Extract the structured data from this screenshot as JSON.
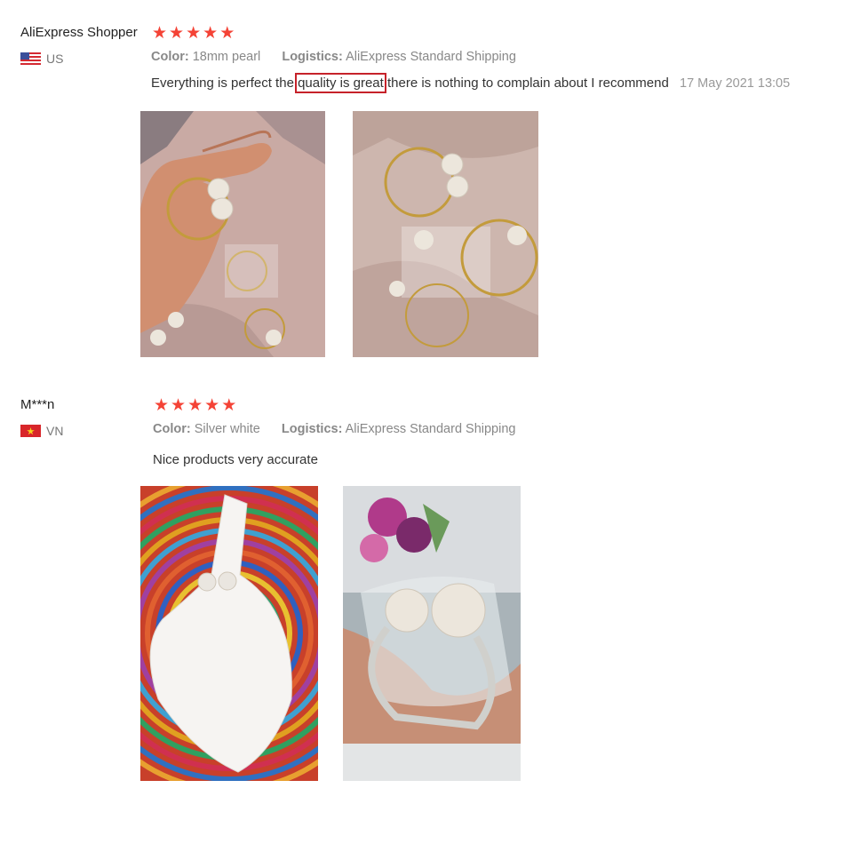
{
  "reviews": [
    {
      "username": "AliExpress Shopper",
      "country": "US",
      "stars": 5,
      "color_label": "Color:",
      "color_value": "18mm pearl",
      "logistics_label": "Logistics:",
      "logistics_value": "AliExpress Standard Shipping",
      "text_before": "Everything is perfect the",
      "text_highlight": "quality is great",
      "text_after": "there is nothing to complain about I recommend",
      "date": "17 May 2021 13:05",
      "photos": [
        "hand-holding-pearl-napkin-ring",
        "pearl-napkin-rings-in-bags"
      ]
    },
    {
      "username": "M***n",
      "country": "VN",
      "stars": 5,
      "color_label": "Color:",
      "color_value": "Silver white",
      "logistics_label": "Logistics:",
      "logistics_value": "AliExpress Standard Shipping",
      "text": "Nice products very accurate",
      "photos": [
        "napkin-in-pearl-ring-on-placemat",
        "hand-holding-wrapped-pearl-ring"
      ]
    }
  ],
  "colors": {
    "star": "#f44336",
    "highlight_border": "#c6222a",
    "muted_text": "#888888"
  }
}
